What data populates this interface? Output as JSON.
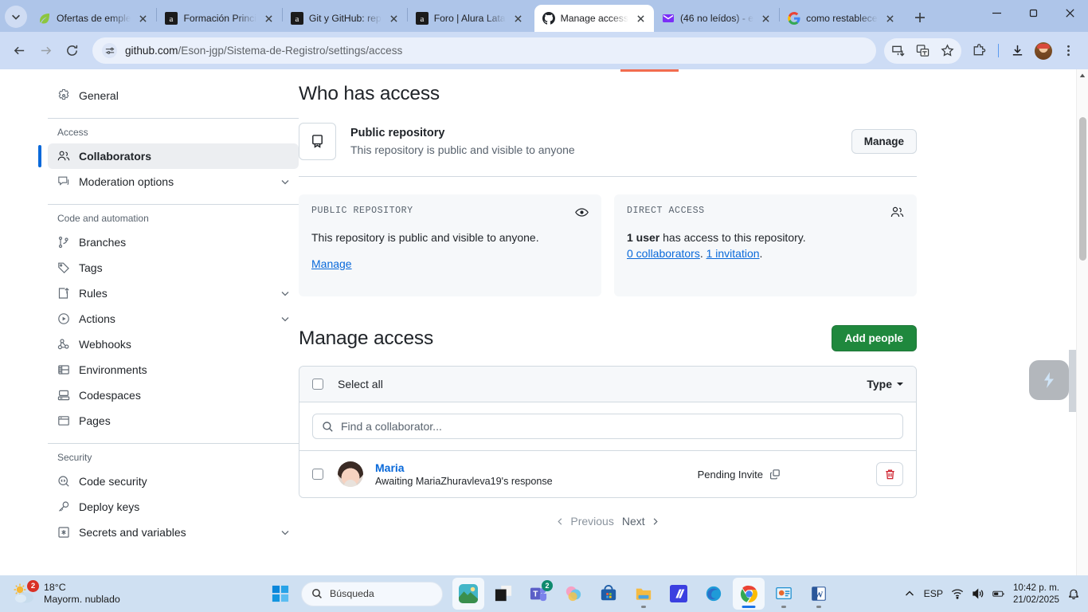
{
  "browser": {
    "tabs": [
      {
        "title": "Ofertas de emple",
        "favicon": "leaf-icon",
        "active": false
      },
      {
        "title": "Formación Princi",
        "favicon": "alura-icon",
        "active": false
      },
      {
        "title": "Git y GitHub: rep",
        "favicon": "alura-icon",
        "active": false
      },
      {
        "title": "Foro | Alura Lata",
        "favicon": "alura-icon",
        "active": false
      },
      {
        "title": "Manage access",
        "favicon": "github-icon",
        "active": true
      },
      {
        "title": "(46 no leídos) - e",
        "favicon": "mail-icon",
        "active": false
      },
      {
        "title": "como restablece",
        "favicon": "google-icon",
        "active": false
      }
    ],
    "url_domain": "github.com",
    "url_path": "/Eson-jgp/Sistema-de-Registro/settings/access",
    "url_full": "github.com/Eson-jgp/Sistema-de-Registro/settings/access"
  },
  "sidebar": {
    "items": [
      {
        "label": "General",
        "icon": "gear-icon",
        "active": false,
        "chevron": false
      },
      {
        "label": "Access",
        "type": "header"
      },
      {
        "label": "Collaborators",
        "icon": "people-icon",
        "active": true,
        "chevron": false
      },
      {
        "label": "Moderation options",
        "icon": "comment-icon",
        "active": false,
        "chevron": true
      },
      {
        "label": "Code and automation",
        "type": "header"
      },
      {
        "label": "Branches",
        "icon": "branch-icon",
        "active": false,
        "chevron": false
      },
      {
        "label": "Tags",
        "icon": "tag-icon",
        "active": false,
        "chevron": false
      },
      {
        "label": "Rules",
        "icon": "rules-icon",
        "active": false,
        "chevron": true
      },
      {
        "label": "Actions",
        "icon": "play-icon",
        "active": false,
        "chevron": true
      },
      {
        "label": "Webhooks",
        "icon": "webhook-icon",
        "active": false,
        "chevron": false
      },
      {
        "label": "Environments",
        "icon": "server-icon",
        "active": false,
        "chevron": false
      },
      {
        "label": "Codespaces",
        "icon": "codespaces-icon",
        "active": false,
        "chevron": false
      },
      {
        "label": "Pages",
        "icon": "browser-icon",
        "active": false,
        "chevron": false
      },
      {
        "label": "Security",
        "type": "header"
      },
      {
        "label": "Code security",
        "icon": "code-shield-icon",
        "active": false,
        "chevron": false
      },
      {
        "label": "Deploy keys",
        "icon": "key-icon",
        "active": false,
        "chevron": false
      },
      {
        "label": "Secrets and variables",
        "icon": "asterisk-icon",
        "active": false,
        "chevron": true
      }
    ]
  },
  "main": {
    "page_title": "Who has access",
    "repo_visibility": {
      "title": "Public repository",
      "subtitle": "This repository is public and visible to anyone",
      "manage_label": "Manage"
    },
    "cards": [
      {
        "label": "PUBLIC REPOSITORY",
        "icon": "eye-icon",
        "body": "This repository is public and visible to anyone.",
        "link": "Manage"
      },
      {
        "label": "DIRECT ACCESS",
        "icon": "people-icon",
        "body_strong": "1 user",
        "body_rest": " has access to this repository.",
        "link1": "0 collaborators",
        "link2": "1 invitation"
      }
    ],
    "manage_access": {
      "heading": "Manage access",
      "add_people_label": "Add people",
      "select_all_label": "Select all",
      "type_label": "Type",
      "search_placeholder": "Find a collaborator...",
      "collaborators": [
        {
          "name": "Maria",
          "status_line": "Awaiting MariaZhuravleva19's response",
          "role": "Pending Invite",
          "delete_icon": "trash-icon"
        }
      ]
    },
    "pagination": {
      "previous": "Previous",
      "next": "Next"
    }
  },
  "taskbar": {
    "weather": {
      "temp": "18°C",
      "desc": "Mayorm. nublado",
      "badge": "2"
    },
    "search_placeholder": "Búsqueda",
    "apps": [
      {
        "name": "wallpaper-app",
        "badge": ""
      },
      {
        "name": "dark-square-app",
        "badge": ""
      },
      {
        "name": "teams-app",
        "badge": "2"
      },
      {
        "name": "copilot-app",
        "badge": ""
      },
      {
        "name": "store-app",
        "badge": ""
      },
      {
        "name": "file-explorer-app",
        "badge": ""
      },
      {
        "name": "alura-app",
        "badge": ""
      },
      {
        "name": "edge-app",
        "badge": ""
      },
      {
        "name": "chrome-app",
        "badge": ""
      },
      {
        "name": "powerpoint-app",
        "badge": ""
      },
      {
        "name": "word-app",
        "badge": ""
      }
    ],
    "tray": {
      "language": "ESP",
      "time": "10:42 p. m.",
      "date": "21/02/2025"
    }
  },
  "colors": {
    "accent_blue": "#0969da",
    "green_button": "#1f883d",
    "danger_red": "#cf222e",
    "progress_orange": "#f26c4f"
  }
}
